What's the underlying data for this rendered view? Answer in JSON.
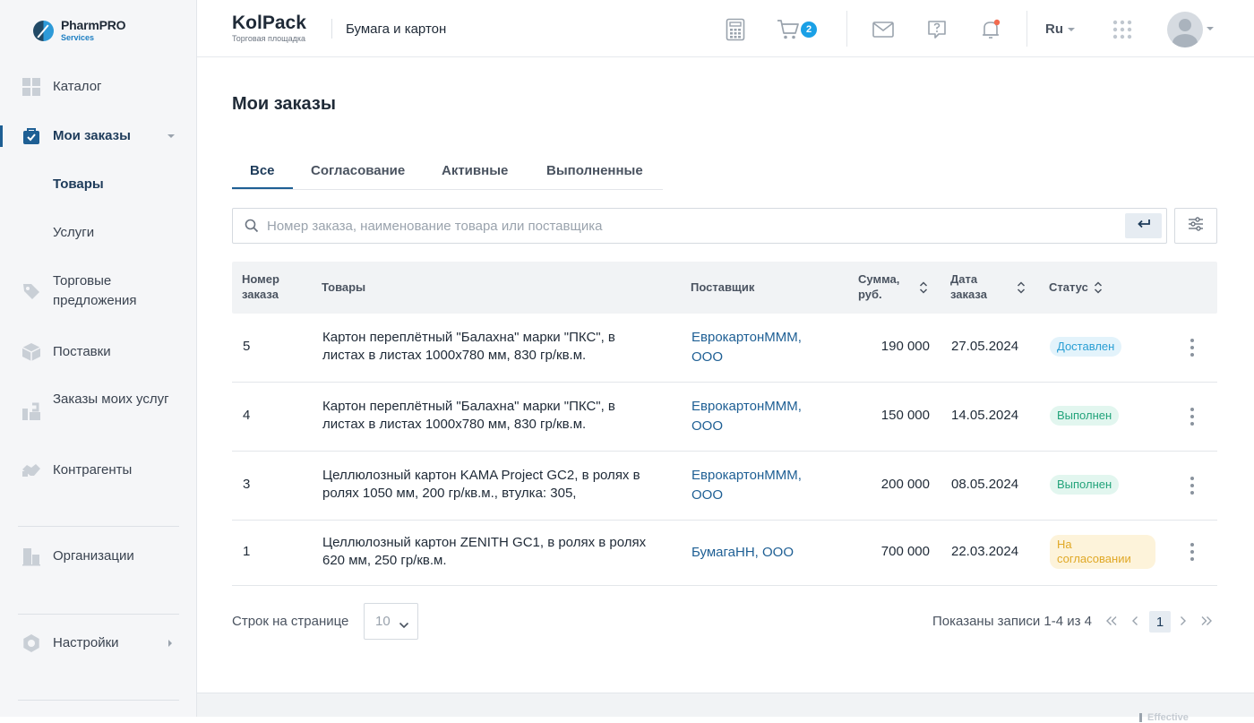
{
  "logo": {
    "name": "PharmPRO",
    "sub": "Services"
  },
  "sidebar": {
    "items": [
      {
        "label": "Каталог",
        "icon": "grid-icon"
      },
      {
        "label": "Мои заказы",
        "icon": "orders-icon"
      },
      {
        "label": "Торговые предложения",
        "icon": "tag-icon"
      },
      {
        "label": "Поставки",
        "icon": "box-icon"
      },
      {
        "label": "Заказы моих услуг",
        "icon": "tools-icon"
      },
      {
        "label": "Контрагенты",
        "icon": "handshake-icon"
      },
      {
        "label": "Организации",
        "icon": "building-icon"
      },
      {
        "label": "Настройки",
        "icon": "gear-icon"
      }
    ],
    "sub_items": [
      {
        "label": "Товары"
      },
      {
        "label": "Услуги"
      }
    ]
  },
  "header": {
    "brand": "KolPack",
    "brand_sub": "Торговая площадка",
    "breadcrumb": "Бумага и картон",
    "cart_count": "2",
    "lang": "Ru"
  },
  "main": {
    "title": "Мои заказы",
    "tabs": [
      {
        "label": "Все"
      },
      {
        "label": "Согласование"
      },
      {
        "label": "Активные"
      },
      {
        "label": "Выполненные"
      }
    ],
    "search": {
      "placeholder": "Номер заказа, наименование товара или поставщика",
      "value": ""
    },
    "columns": {
      "order_no": "Номер заказа",
      "goods": "Товары",
      "supplier": "Поставщик",
      "sum": "Сумма, руб.",
      "date": "Дата заказа",
      "status": "Статус"
    },
    "rows": [
      {
        "order_no": "5",
        "goods": "Картон переплётный \"Балахна\" марки \"ПКС\", в листах в листах 1000х780 мм, 830 гр/кв.м.",
        "supplier": "ЕврокартонМММ, ООО",
        "sum": "190 000",
        "date": "27.05.2024",
        "status": "Доставлен"
      },
      {
        "order_no": "4",
        "goods": "Картон переплётный \"Балахна\" марки \"ПКС\", в листах в листах 1000х780 мм, 830 гр/кв.м.",
        "supplier": "ЕврокартонМММ, ООО",
        "sum": "150 000",
        "date": "14.05.2024",
        "status": "Выполнен"
      },
      {
        "order_no": "3",
        "goods": "Целлюлозный картон KAMA Project GC2, в ролях в ролях 1050 мм, 200 гр/кв.м., втулка: 305,",
        "supplier": "ЕврокартонМММ, ООО",
        "sum": "200 000",
        "date": "08.05.2024",
        "status": "Выполнен"
      },
      {
        "order_no": "1",
        "goods": "Целлюлозный картон ZENITH GC1, в ролях в ролях 620 мм, 250 гр/кв.м.",
        "supplier": "БумагаНН, ООО",
        "sum": "700 000",
        "date": "22.03.2024",
        "status": "На согласовании"
      }
    ],
    "pagination": {
      "rows_label": "Строк на странице",
      "rows_value": "10",
      "records": "Показаны записи 1-4 из 4",
      "current_page": "1"
    }
  },
  "footer": {
    "mark": "Effective"
  },
  "colors": {
    "accent": "#1e5f94",
    "badge_blue": "#1aa0e6",
    "status_delivered": "#2a9fd4",
    "status_done": "#22a37a",
    "status_pending": "#e0a826"
  }
}
